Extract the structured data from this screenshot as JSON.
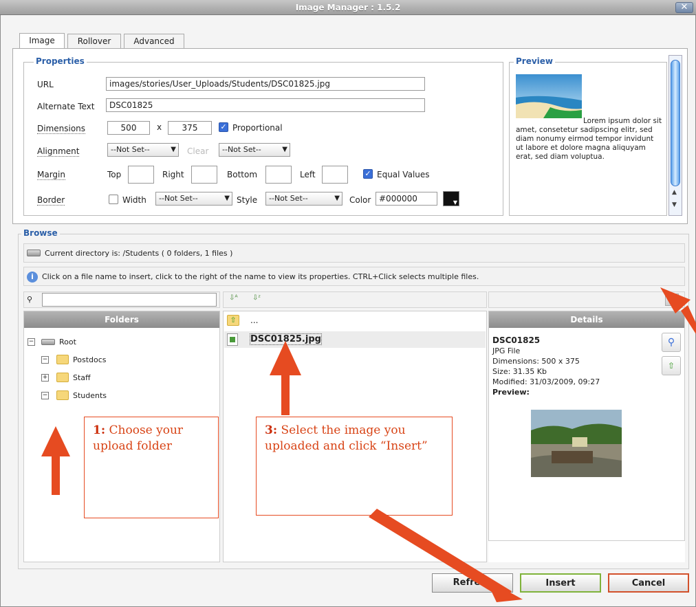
{
  "window": {
    "title": "Image Manager : 1.5.2",
    "close_label": "✕"
  },
  "tabs": [
    "Image",
    "Rollover",
    "Advanced"
  ],
  "properties": {
    "legend": "Properties",
    "url_label": "URL",
    "url_value": "images/stories/User_Uploads/Students/DSC01825.jpg",
    "alt_label": "Alternate Text",
    "alt_value": "DSC01825",
    "dimensions_label": "Dimensions",
    "width_value": "500",
    "times": "x",
    "height_value": "375",
    "proportional_label": "Proportional",
    "alignment_label": "Alignment",
    "align_value": "--Not Set--",
    "clear_label": "Clear",
    "clear_value": "--Not Set--",
    "margin_label": "Margin",
    "top_label": "Top",
    "right_label": "Right",
    "bottom_label": "Bottom",
    "left_label": "Left",
    "equal_values_label": "Equal Values",
    "border_label": "Border",
    "border_width_label": "Width",
    "border_width_value": "--Not Set--",
    "border_style_label": "Style",
    "border_style_value": "--Not Set--",
    "border_color_label": "Color",
    "border_color_value": "#000000"
  },
  "preview": {
    "legend": "Preview",
    "lorem": "Lorem ipsum dolor sit amet, consetetur sadipscing elitr, sed diam nonumy eirmod tempor invidunt ut labore et dolore magna aliquyam erat, sed diam voluptua."
  },
  "browse": {
    "legend": "Browse",
    "current_dir": "Current directory is: /Students ( 0 folders, 1 files )",
    "info": "Click on a file name to insert, click to the right of the name to view its properties. CTRL+Click selects multiple files.",
    "search_placeholder": ""
  },
  "folders": {
    "header": "Folders",
    "items": [
      "Root",
      "Postdocs",
      "Staff",
      "Students"
    ]
  },
  "files": {
    "up_label": "...",
    "items": [
      "DSC01825.jpg"
    ]
  },
  "details": {
    "header": "Details",
    "name": "DSC01825",
    "type": "JPG File",
    "dimensions": "Dimensions: 500 x 375",
    "size": "Size: 31.35 Kb",
    "modified": "Modified: 31/03/2009, 09:27",
    "preview_label": "Preview:"
  },
  "buttons": {
    "refresh": "Refresh",
    "insert": "Insert",
    "cancel": "Cancel"
  },
  "notes": {
    "note1_num": "1:",
    "note1_text": " Choose your upload folder",
    "note3_num": "3:",
    "note3_text": " Select the image you uploaded and click “Insert”"
  },
  "colors": {
    "accent": "#2b5fa8",
    "annotation": "#e64b21"
  }
}
